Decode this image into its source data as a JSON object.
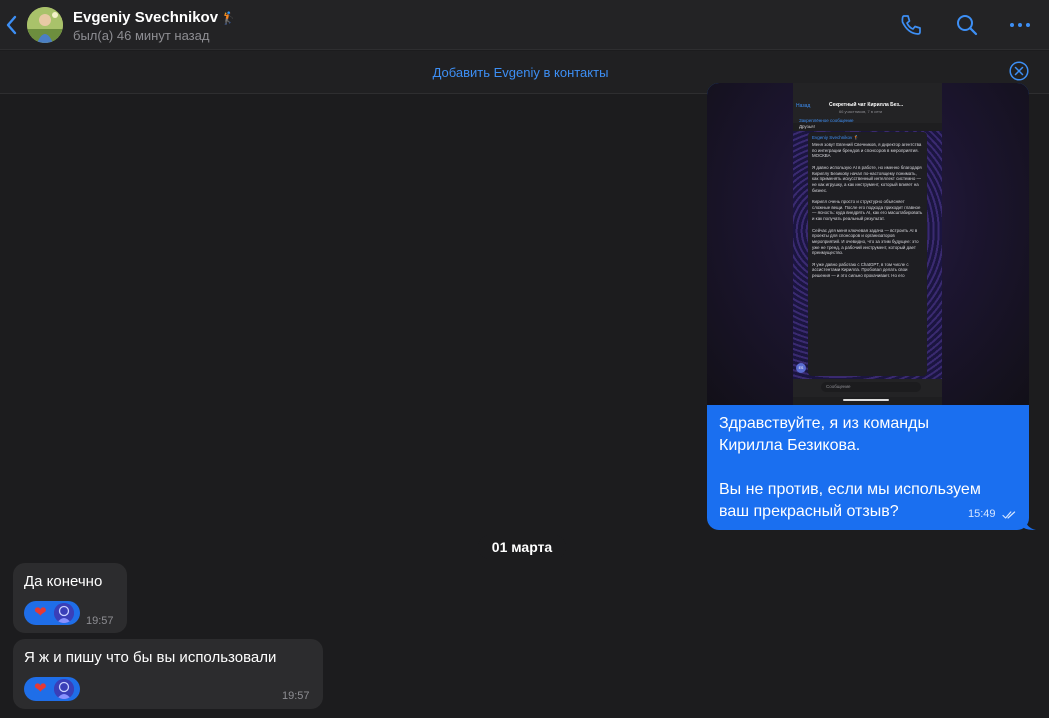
{
  "header": {
    "contact_name": "Evgeniy Svechnikov",
    "name_emoji": "🏌",
    "last_seen": "был(а) 46 минут назад",
    "icons": [
      "back-chevron-icon",
      "phone-icon",
      "search-icon",
      "more-icon"
    ]
  },
  "add_contact": {
    "label": "Добавить Evgeniy в контакты"
  },
  "outgoing": {
    "text": "Здравствуйте, я из команды\nКирилла Безикова.\n\nВы не против, если мы используем\nваш прекрасный отзыв?",
    "time": "15:49",
    "status": "read",
    "screenshot": {
      "back_label": "Назад",
      "chat_title": "Секретный чат Кирилла Без...",
      "chat_subtitle": "66 участников, 7 в сети",
      "pinned_label": "Закреплённое сообщение",
      "pinned_text": "Друзья!",
      "author": "Evgeniy Svechnikov 🏌",
      "body": "Меня зовут Евгений Свечников, я директор агентства по интеграции брендов и спонсоров в мероприятия. МОСКВА\n\nЯ давно использую AI в работе, но именно благодаря Кириллу Безикову начал по-настоящему понимать, как применять искусственный интеллект системно — не как игрушку, а как инструмент, который влияет на бизнес.\n\nКирилл очень просто и структурно объясняет сложные вещи. После его подхода приходит главное — ясность: куда внедрять AI, как его масштабировать и как получать реальный результат.\n\nСейчас для меня ключевая задача — встроить AI в проекты для спонсоров и организаторов мероприятий. И очевидно, что за этим будущее: это уже не тренд, а рабочий инструмент, который дает преимущество.\n\nЯ уже давно работаю с ChatGPT, в том числе с ассистентами Кирилла. Пробовал делать свои решения — и это сильно прокачивает. Но его",
      "avatar_initials": "ES",
      "input_placeholder": "Сообщение"
    }
  },
  "date_separator": "01 марта",
  "incoming": [
    {
      "text": "Да конечно",
      "time": "19:57",
      "reaction": "❤"
    },
    {
      "text": "Я ж и пишу что бы вы использовали",
      "time": "19:57",
      "reaction": "❤"
    }
  ],
  "colors": {
    "background": "#1c1c1e",
    "accent": "#1a6ff0",
    "link": "#3d8ff5",
    "incoming_bubble": "#2c2c2e"
  }
}
